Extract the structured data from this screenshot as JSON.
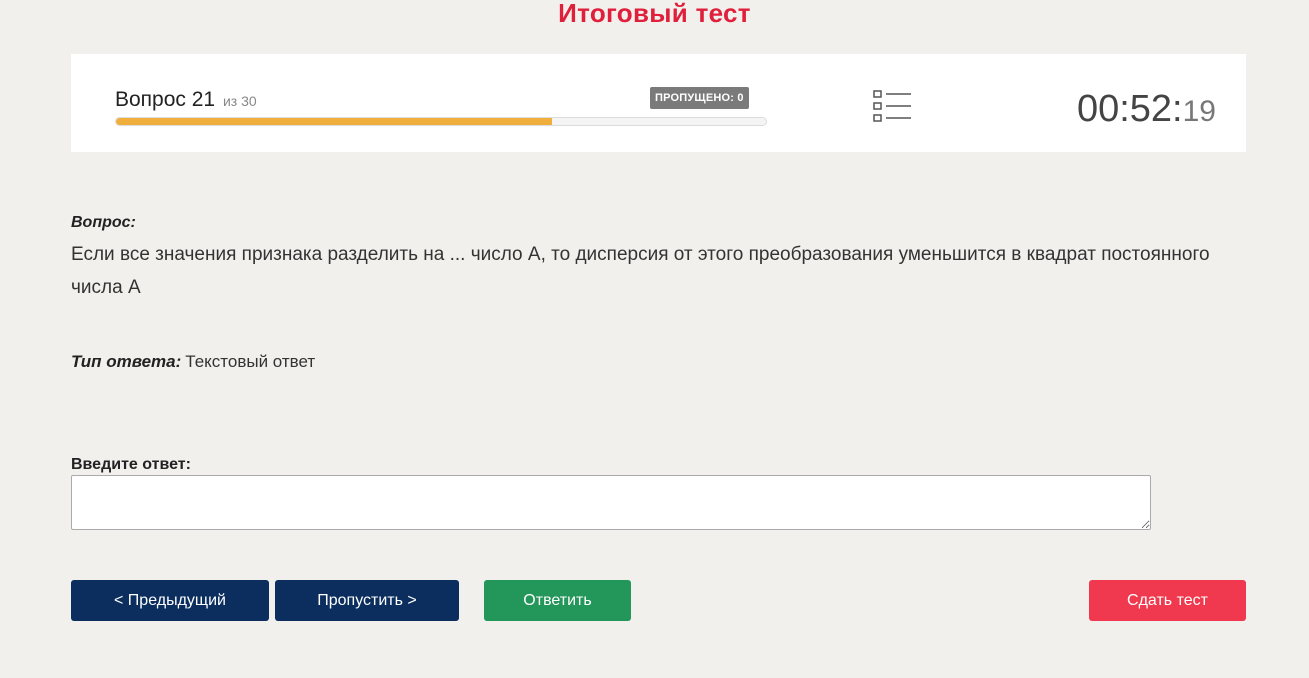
{
  "page_title": "Итоговый тест",
  "status": {
    "question_label": "Вопрос 21",
    "question_of": "из 30",
    "current": 21,
    "total": 30,
    "progress_fraction": 0.67,
    "skipped_badge": "ПРОПУЩЕНО: 0",
    "list_icon": "question-list-icon",
    "timer_main": "00:52:",
    "timer_seconds": "19"
  },
  "question": {
    "caption": "Вопрос:",
    "text": "Если все значения признака разделить на ... число А, то дисперсия от этого преобразования уменьшится в квадрат постоянного числа А"
  },
  "answer_type": {
    "label": "Тип ответа:",
    "value": "Текстовый ответ"
  },
  "answer_input": {
    "label": "Введите ответ:",
    "value": "",
    "placeholder": ""
  },
  "buttons": {
    "prev": "< Предыдущий",
    "skip": "Пропустить >",
    "answer": "Ответить",
    "submit": "Сдать тест"
  },
  "colors": {
    "title": "#e0203a",
    "progress": "#f0ae3c",
    "nav_button": "#0b2e5e",
    "answer_button": "#23965a",
    "submit_button": "#f0394e",
    "badge": "#7a7a7a"
  }
}
